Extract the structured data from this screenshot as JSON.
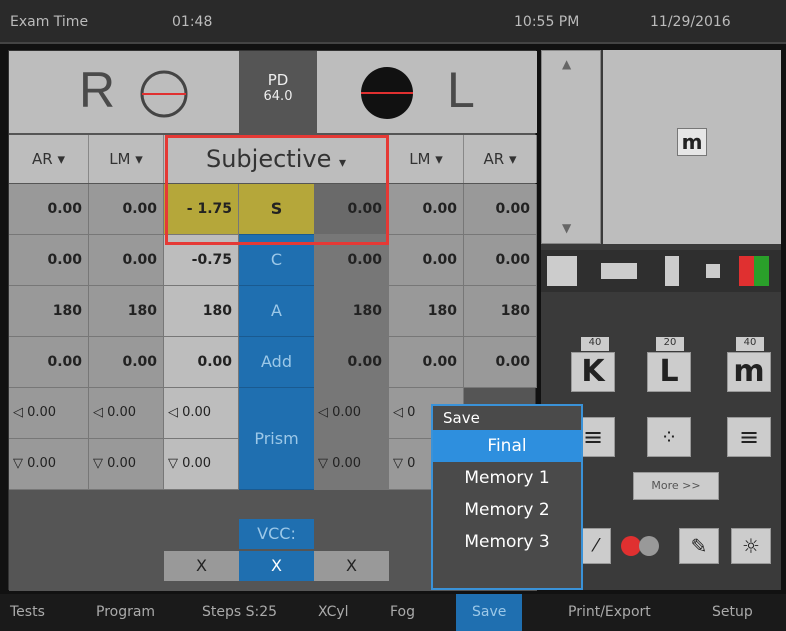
{
  "topbar": {
    "exam_label": "Exam Time",
    "exam_time": "01:48",
    "clock": "10:55  PM",
    "date": "11/29/2016"
  },
  "eyes": {
    "right_label": "R",
    "left_label": "L",
    "pd_label": "PD",
    "pd_value": "64.0"
  },
  "columns": {
    "ar_left": "AR",
    "lm_left": "LM",
    "subjective": "Subjective",
    "lm_right": "LM",
    "ar_right": "AR"
  },
  "rows": [
    {
      "key": "S",
      "ar_r": "0.00",
      "lm_r": "0.00",
      "subj_r": "- 1.75",
      "subj_l": "0.00",
      "lm_l": "0.00",
      "ar_l": "0.00"
    },
    {
      "key": "C",
      "ar_r": "0.00",
      "lm_r": "0.00",
      "subj_r": "-0.75",
      "subj_l": "0.00",
      "lm_l": "0.00",
      "ar_l": "0.00"
    },
    {
      "key": "A",
      "ar_r": "180",
      "lm_r": "180",
      "subj_r": "180",
      "subj_l": "180",
      "lm_l": "180",
      "ar_l": "180"
    },
    {
      "key": "Add",
      "ar_r": "0.00",
      "lm_r": "0.00",
      "subj_r": "0.00",
      "subj_l": "0.00",
      "lm_l": "0.00",
      "ar_l": "0.00"
    }
  ],
  "prism": {
    "label": "Prism",
    "row1": {
      "ar_r": "◁  0.00",
      "lm_r": "◁  0.00",
      "subj_r": "◁  0.00",
      "subj_l": "◁  0.00",
      "lm_l": "◁  0"
    },
    "row2": {
      "ar_r": "▽  0.00",
      "lm_r": "▽  0.00",
      "subj_r": "▽  0.00",
      "subj_l": "▽  0.00",
      "lm_l": "▽  0"
    }
  },
  "vcc": {
    "label": "VCC:",
    "x1": "X",
    "x2": "X",
    "x3": "X"
  },
  "chart": {
    "main_symbol": "m",
    "tiles": [
      {
        "top": "40",
        "glyph": "K"
      },
      {
        "top": "20",
        "glyph": "L"
      },
      {
        "top": "40",
        "glyph": "m"
      }
    ],
    "more_label": "More >>"
  },
  "save_menu": {
    "title": "Save",
    "items": [
      "Final",
      "Memory 1",
      "Memory 2",
      "Memory 3"
    ]
  },
  "bottombar": {
    "items": [
      "Tests",
      "Program",
      "Steps S:25",
      "XCyl",
      "Fog",
      "Save",
      "Print/Export",
      "Setup"
    ]
  },
  "colors": {
    "accent": "#1f6fb0",
    "highlight": "#e53935",
    "final_blue": "#2e8fde",
    "sphere_yellow": "#b5a73a"
  }
}
